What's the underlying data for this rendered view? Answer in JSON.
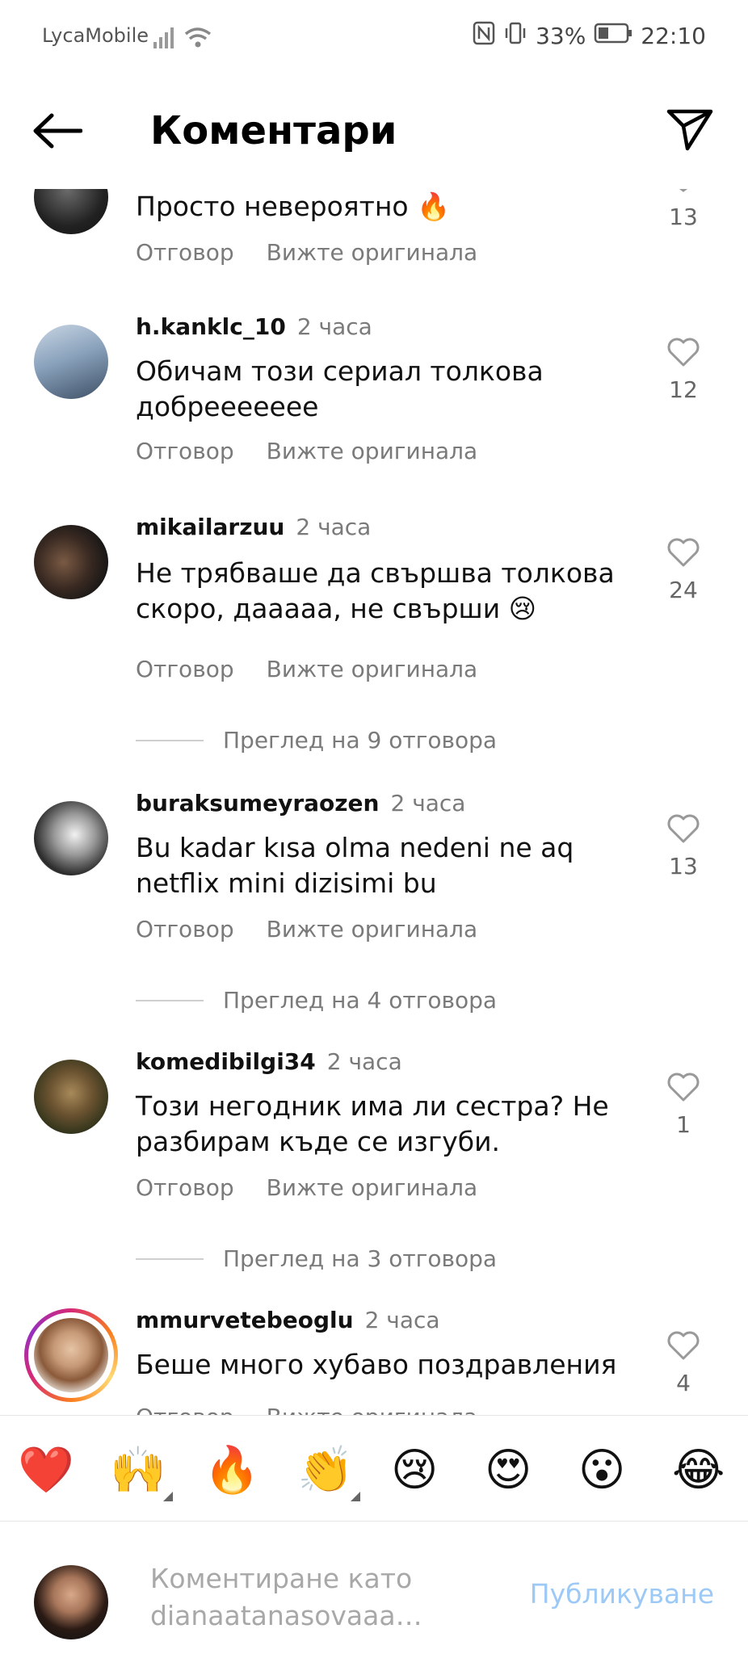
{
  "status": {
    "carrier": "LycaMobile",
    "battery": "33%",
    "time": "22:10"
  },
  "header": {
    "title": "Коментари"
  },
  "labels": {
    "reply": "Отговор",
    "see_original": "Вижте оригинала"
  },
  "comments": [
    {
      "user": "",
      "time": "",
      "text": "Просто невероятно 🔥",
      "likes": "13"
    },
    {
      "user": "h.kanklc_10",
      "time": "2 часа",
      "text": "Обичам този сериал толкова добреееееее",
      "likes": "12"
    },
    {
      "user": "mikailarzuu",
      "time": "2 часа",
      "text": "Не трябваше да свършва толкова скоро, дааааа, не свърши 😢",
      "likes": "24",
      "replies": "Преглед на 9 отговора"
    },
    {
      "user": "buraksumeyraozen",
      "time": "2 часа",
      "text": "Bu kadar kısa olma nedeni ne aq netflix mini dizisimi bu",
      "likes": "13",
      "replies": "Преглед на 4 отговора"
    },
    {
      "user": "komedibilgi34",
      "time": "2 часа",
      "text": "Този негодник има ли сестра? Не разбирам къде се изгуби.",
      "likes": "1",
      "replies": "Преглед на 3 отговора"
    },
    {
      "user": "mmurvetebeoglu",
      "time": "2 часа",
      "text": "Беше много хубаво поздравления",
      "likes": "4"
    }
  ],
  "emojis": [
    "❤️",
    "🙌",
    "🔥",
    "👏",
    "😢",
    "😍",
    "😮",
    "😂"
  ],
  "composer": {
    "placeholder": "Коментиране като dianaatanasovaaa…",
    "publish": "Публикуване"
  },
  "colors": {
    "publish_disabled": "#9cc9f6",
    "muted": "#7a7a7a"
  }
}
